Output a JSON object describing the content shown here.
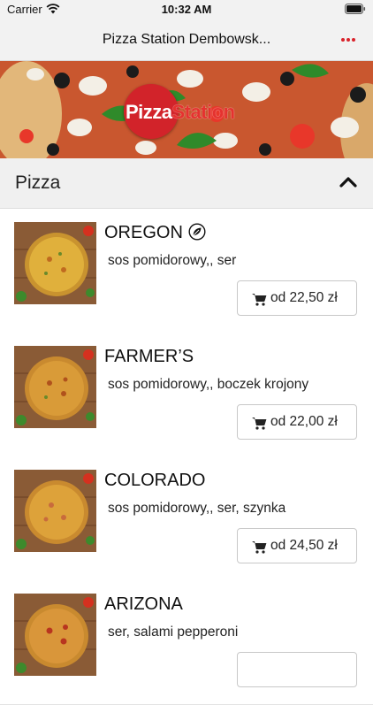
{
  "status_bar": {
    "carrier": "Carrier",
    "time": "10:32 AM",
    "wifi_icon": "wifi-icon",
    "battery_icon": "battery-icon"
  },
  "nav": {
    "title": "Pizza Station Dembowsk...",
    "menu_icon": "more-dots-icon",
    "accent": "#d9232b"
  },
  "banner": {
    "logo_text_1": "Pizza",
    "logo_text_2": "Station"
  },
  "section": {
    "title": "Pizza",
    "chevron_icon": "chevron-up-icon"
  },
  "items": [
    {
      "name": "OREGON",
      "has_leaf_icon": true,
      "description": "sos pomidorowy,, ser",
      "price": "od 22,50 zł"
    },
    {
      "name": "FARMER’S",
      "has_leaf_icon": false,
      "description": "sos pomidorowy,, boczek krojony",
      "price": "od 22,00 zł"
    },
    {
      "name": "COLORADO",
      "has_leaf_icon": false,
      "description": "sos pomidorowy,, ser, szynka",
      "price": "od 24,50 zł"
    },
    {
      "name": "ARIZONA",
      "has_leaf_icon": false,
      "description": "ser, salami pepperoni",
      "price": ""
    }
  ]
}
